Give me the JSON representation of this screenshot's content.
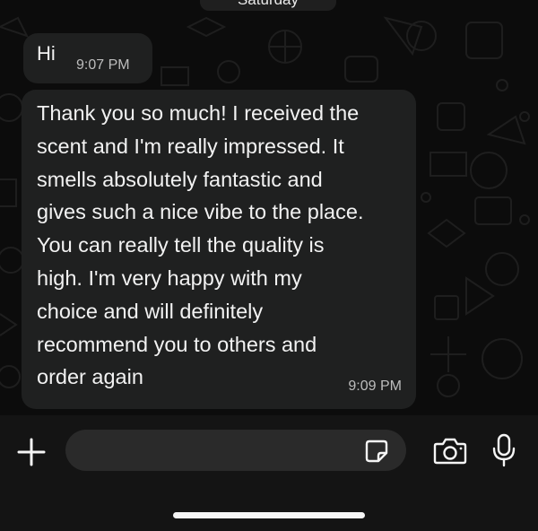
{
  "date_separator": "Saturday",
  "messages": [
    {
      "text": "Hi",
      "time": "9:07 PM"
    },
    {
      "text": "Thank you so much! I received the\nscent and I'm really impressed. It\nsmells absolutely fantastic and\ngives such a nice vibe to the place.\nYou can really tell the quality is\nhigh. I'm very happy with my\nchoice and will definitely\nrecommend you to others and\norder again",
      "time": "9:09 PM"
    }
  ],
  "input": {
    "placeholder": ""
  },
  "icons": {
    "attach": "plus-icon",
    "sticker": "sticker-icon",
    "camera": "camera-icon",
    "mic": "microphone-icon"
  },
  "colors": {
    "background": "#0c0c0c",
    "bubble": "#1f2020",
    "text": "#f2f2f2",
    "timestamp": "#bdbdbd",
    "input_bar": "#141414",
    "input_field": "#2a2a2a"
  }
}
